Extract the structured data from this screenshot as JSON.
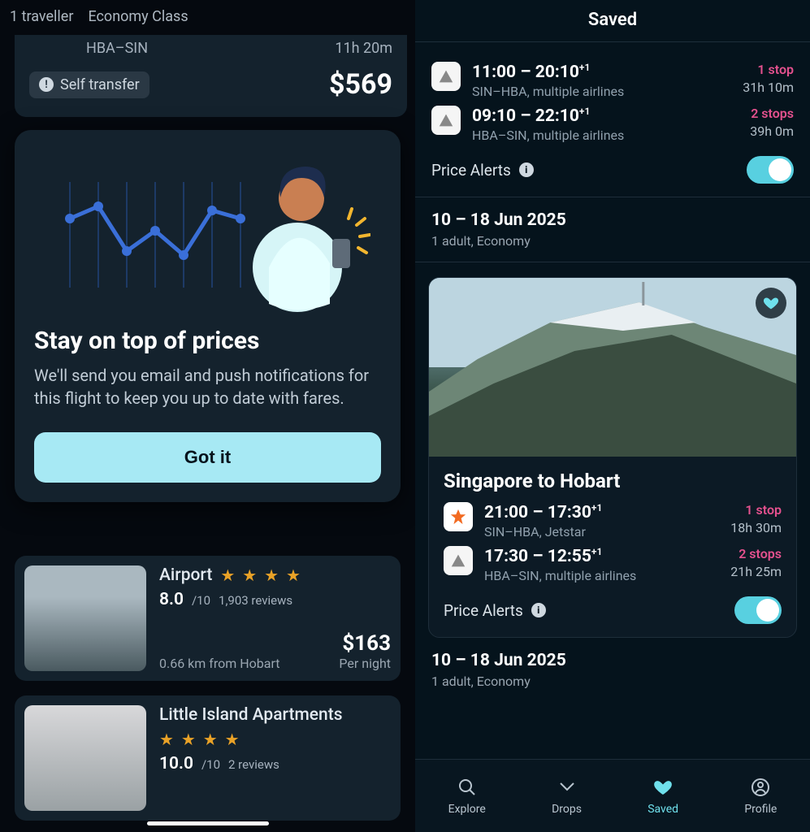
{
  "left": {
    "filters": {
      "pax": "1 traveller",
      "cabin": "Economy Class"
    },
    "flight": {
      "route": "HBA–SIN",
      "duration": "11h 20m",
      "self_transfer_label": "Self transfer",
      "price": "$569"
    },
    "dialog": {
      "title": "Stay on top of prices",
      "body": "We'll send you email and push notifications for this flight to keep you up to date with fares.",
      "cta": "Got it"
    },
    "hotels": [
      {
        "name": "Airport",
        "stars": 4,
        "rating": "8.0",
        "rating_of": "/10",
        "reviews": "1,903 reviews",
        "distance": "0.66 km from Hobart",
        "price": "$163",
        "per": "Per night"
      },
      {
        "name": "Little Island Apartments",
        "stars": 4,
        "rating": "10.0",
        "rating_of": "/10",
        "reviews": "2 reviews",
        "distance": "",
        "price": "",
        "per": ""
      }
    ]
  },
  "right": {
    "title": "Saved",
    "card1": {
      "legs": [
        {
          "times": "11:00 – 20:10",
          "plus": "+1",
          "sub": "SIN–HBA, multiple airlines",
          "stops": "1 stop",
          "dur": "31h 10m",
          "airline_icon": "generic"
        },
        {
          "times": "09:10 – 22:10",
          "plus": "+1",
          "sub": "HBA–SIN, multiple airlines",
          "stops": "2 stops",
          "dur": "39h 0m",
          "airline_icon": "generic"
        }
      ],
      "alerts_label": "Price Alerts",
      "alerts_on": true,
      "meta": {
        "dates": "10 – 18 Jun 2025",
        "pax": "1 adult, Economy"
      }
    },
    "card2": {
      "title": "Singapore to Hobart",
      "legs": [
        {
          "times": "21:00 – 17:30",
          "plus": "+1",
          "sub": "SIN–HBA, Jetstar",
          "stops": "1 stop",
          "dur": "18h 30m",
          "airline_icon": "jetstar"
        },
        {
          "times": "17:30 – 12:55",
          "plus": "+1",
          "sub": "HBA–SIN, multiple airlines",
          "stops": "2 stops",
          "dur": "21h 25m",
          "airline_icon": "generic"
        }
      ],
      "alerts_label": "Price Alerts",
      "alerts_on": true,
      "meta": {
        "dates": "10 – 18 Jun 2025",
        "pax": "1 adult, Economy"
      }
    },
    "tabs": [
      {
        "id": "explore",
        "label": "Explore",
        "active": false
      },
      {
        "id": "drops",
        "label": "Drops",
        "active": false
      },
      {
        "id": "saved",
        "label": "Saved",
        "active": true
      },
      {
        "id": "profile",
        "label": "Profile",
        "active": false
      }
    ]
  }
}
